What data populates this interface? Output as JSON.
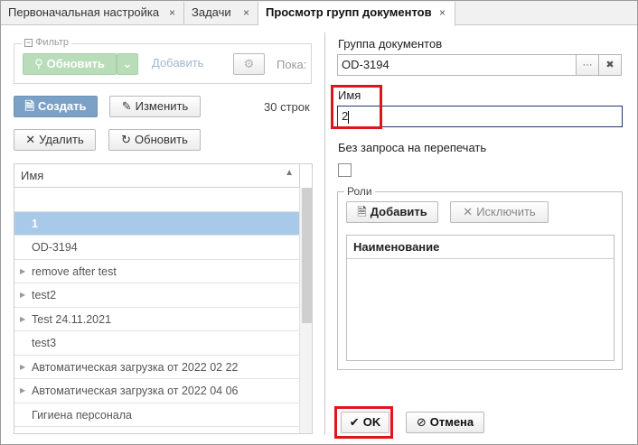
{
  "tabs": [
    {
      "label": "Первоначальная настройка",
      "close": "×"
    },
    {
      "label": "Задачи",
      "close": "×"
    },
    {
      "label": "Просмотр групп документов",
      "close": "×",
      "active": true
    }
  ],
  "left": {
    "filter_legend": "Фильтр",
    "refresh_green_label": "Обновить",
    "add_label": "Добавить",
    "show_label": "Пока:",
    "create_label": "Создать",
    "edit_label": "Изменить",
    "row_count": "30 строк",
    "delete_label": "Удалить",
    "refresh_label": "Обновить",
    "grid_header": "Имя",
    "rows": [
      {
        "label": "",
        "expandable": false,
        "selected": false
      },
      {
        "label": "1",
        "expandable": false,
        "selected": true
      },
      {
        "label": "OD-3194",
        "expandable": false,
        "selected": false
      },
      {
        "label": "remove after test",
        "expandable": true,
        "selected": false
      },
      {
        "label": "test2",
        "expandable": true,
        "selected": false
      },
      {
        "label": "Test 24.11.2021",
        "expandable": true,
        "selected": false
      },
      {
        "label": "test3",
        "expandable": false,
        "selected": false
      },
      {
        "label": "Автоматическая загрузка от 2022 02 22",
        "expandable": true,
        "selected": false
      },
      {
        "label": "Автоматическая загрузка от 2022 04 06",
        "expandable": true,
        "selected": false
      },
      {
        "label": "Гигиена персонала",
        "expandable": false,
        "selected": false
      }
    ]
  },
  "right": {
    "group_label": "Группа документов",
    "group_value": "OD-3194",
    "group_more": "···",
    "group_clear": "✖",
    "name_label": "Имя",
    "name_value": "2",
    "no_reprint_label": "Без запроса на перепечать",
    "no_reprint_checked": false,
    "roles_legend": "Роли",
    "roles_add": "Добавить",
    "roles_exclude": "Исключить",
    "roles_col": "Наименование",
    "ok_label": "OK",
    "cancel_label": "Отмена"
  },
  "colors": {
    "highlight": "#e0141e",
    "selection": "#a9c9e8",
    "primary": "#7ba2c6",
    "green": "#b9ddb9"
  }
}
